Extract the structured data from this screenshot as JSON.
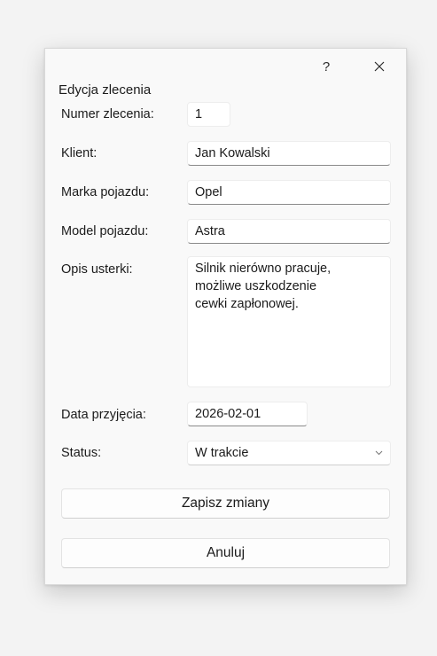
{
  "dialog": {
    "title": "Edycja zlecenia",
    "help_label": "?",
    "close_icon": "close-icon"
  },
  "form": {
    "order_number": {
      "label": "Numer zlecenia:",
      "value": "1"
    },
    "client": {
      "label": "Klient:",
      "value": "Jan Kowalski"
    },
    "vehicle_make": {
      "label": "Marka pojazdu:",
      "value": "Opel"
    },
    "vehicle_model": {
      "label": "Model pojazdu:",
      "value": "Astra"
    },
    "fault_description": {
      "label": "Opis usterki:",
      "value": "Silnik nierówno pracuje,\nmożliwe uszkodzenie\ncewki zapłonowej."
    },
    "date_received": {
      "label": "Data przyjęcia:",
      "value": "2026-02-01"
    },
    "status": {
      "label": "Status:",
      "value": "W trakcie",
      "icon": "chevron-down-icon"
    }
  },
  "buttons": {
    "save_label": "Zapisz zmiany",
    "cancel_label": "Anuluj"
  },
  "colors": {
    "background": "#f3f3f3",
    "dialog": "#f9f9f9",
    "field": "#ffffff",
    "text": "#1b1b1b"
  }
}
